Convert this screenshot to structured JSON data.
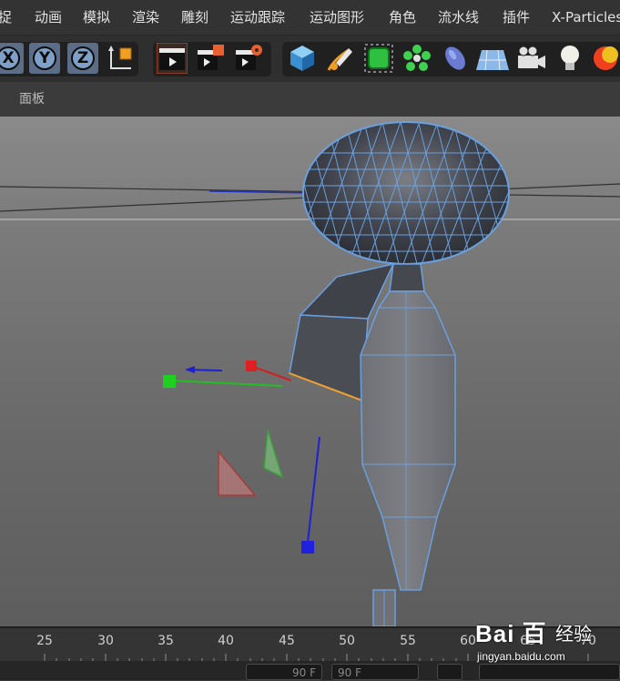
{
  "menu": {
    "items": [
      "捉",
      "动画",
      "模拟",
      "渲染",
      "雕刻",
      "运动跟踪",
      "运动图形",
      "角色",
      "流水线",
      "插件",
      "X-Particles"
    ]
  },
  "toolbar": {
    "axis_x": "X",
    "axis_y": "Y",
    "axis_z": "Z",
    "icons": [
      "coordinate-system-icon",
      "render-view-icon",
      "render-picture-viewer-icon",
      "render-settings-icon",
      "cube-icon",
      "pen-spline-icon",
      "subdivision-icon",
      "cloner-icon",
      "deformer-icon",
      "floor-icon",
      "camera-icon",
      "light-icon",
      "material-icon"
    ]
  },
  "panel": {
    "label": "面板"
  },
  "timeline": {
    "ticks": [
      "25",
      "30",
      "35",
      "40",
      "45",
      "50",
      "55",
      "60",
      "65",
      "70"
    ],
    "frame_field_left": "90 F",
    "frame_field_right": "90 F"
  },
  "watermark": {
    "logo": "Bai  百",
    "name_cn": "经验",
    "url": "jingyan.baidu.com"
  },
  "colors": {
    "menubar_bg": "#333333",
    "toolbar_bg": "#2f2f2f",
    "axis_active": "#7fa0c9",
    "viewport_top": "#8a8a8a",
    "mesh_wire": "#6aa0e0",
    "axis_x_color": "#e02020",
    "axis_y_color": "#20d020",
    "axis_z_color": "#2020e0"
  }
}
